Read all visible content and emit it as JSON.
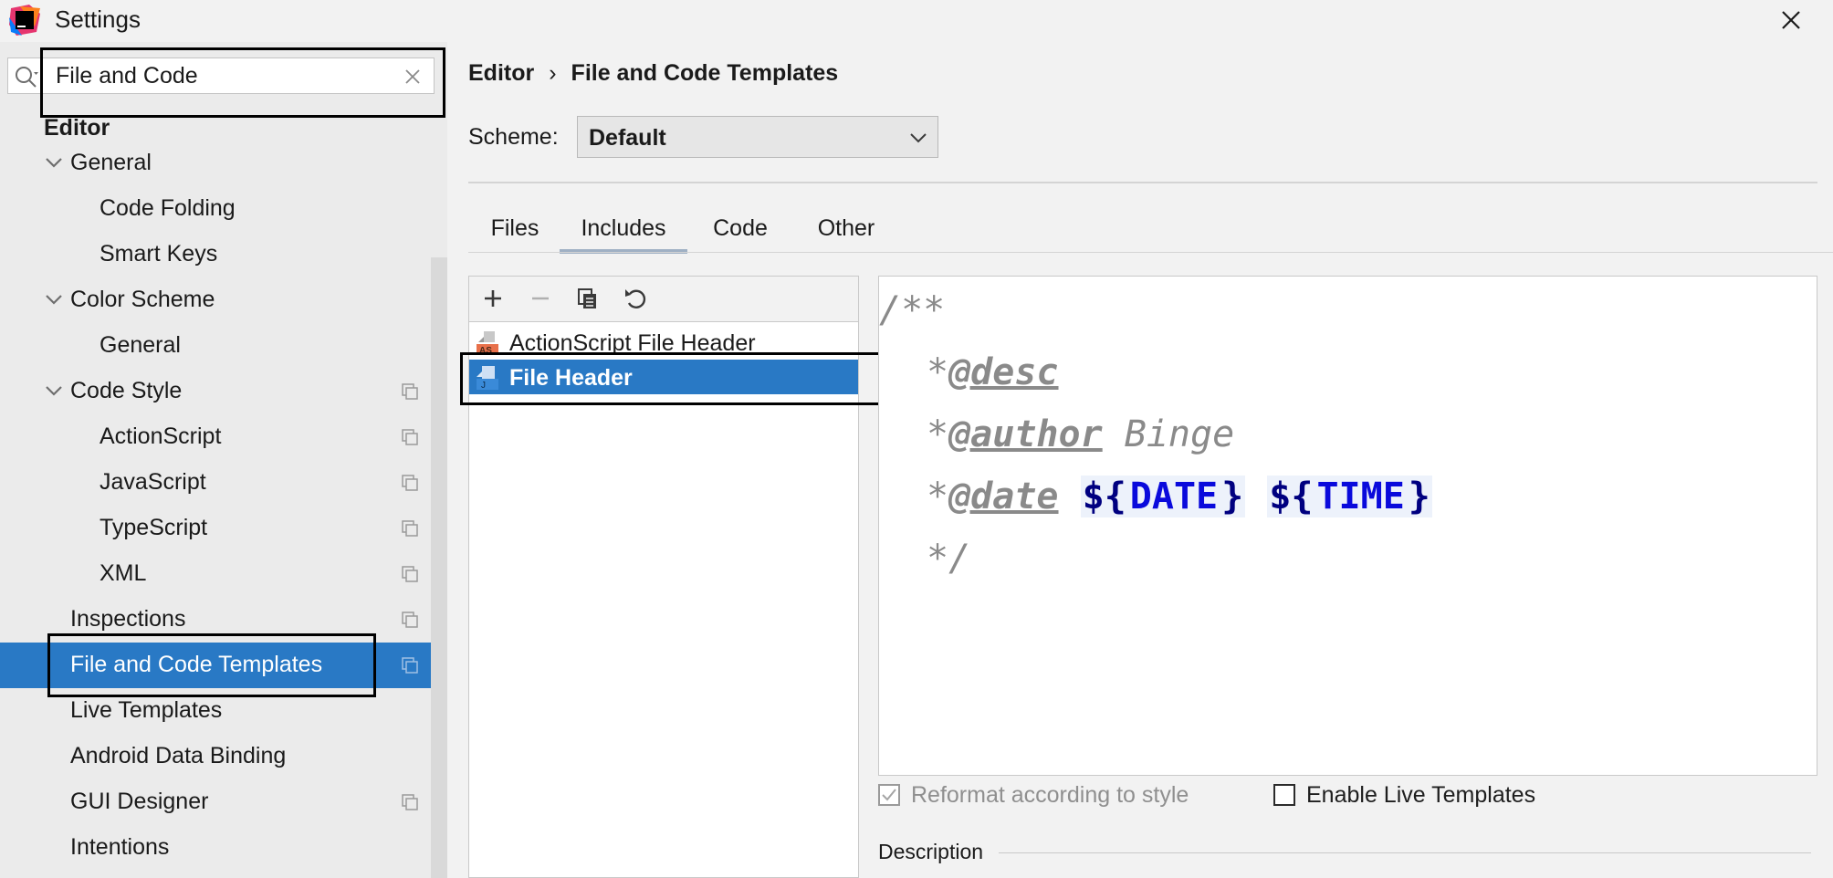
{
  "window": {
    "title": "Settings"
  },
  "search": {
    "value": "File and Code",
    "placeholder": ""
  },
  "sidebar": {
    "section": "Editor",
    "items": [
      {
        "label": "General"
      },
      {
        "label": "Code Folding"
      },
      {
        "label": "Smart Keys"
      },
      {
        "label": "Color Scheme"
      },
      {
        "label": "General"
      },
      {
        "label": "Code Style"
      },
      {
        "label": "ActionScript"
      },
      {
        "label": "JavaScript"
      },
      {
        "label": "TypeScript"
      },
      {
        "label": "XML"
      },
      {
        "label": "Inspections"
      },
      {
        "label": "File and Code Templates"
      },
      {
        "label": "Live Templates"
      },
      {
        "label": "Android Data Binding"
      },
      {
        "label": "GUI Designer"
      },
      {
        "label": "Intentions"
      }
    ]
  },
  "breadcrumb": {
    "parent": "Editor",
    "separator": "›",
    "current": "File and Code Templates"
  },
  "scheme": {
    "label": "Scheme:",
    "value": "Default"
  },
  "tabs": [
    {
      "label": "Files"
    },
    {
      "label": "Includes"
    },
    {
      "label": "Code"
    },
    {
      "label": "Other"
    }
  ],
  "templates": [
    {
      "label": "ActionScript File Header",
      "icon": "actionscript-file-icon",
      "icon_badge": "AS"
    },
    {
      "label": "File Header",
      "icon": "java-file-icon",
      "icon_badge": "J"
    }
  ],
  "editor": {
    "line1": "/**",
    "line2_star": "*",
    "line2_tag": "@desc",
    "line3_star": "*",
    "line3_tag": "@author",
    "line3_text": " Binge",
    "line4_star": "*",
    "line4_tag": "@date",
    "line4_var1_open": "${",
    "line4_var1_name": "DATE",
    "line4_var1_close": "}",
    "line4_var2_open": "${",
    "line4_var2_name": "TIME",
    "line4_var2_close": "}",
    "line5": "*/"
  },
  "options": {
    "reformat_label": "Reformat according to style",
    "live_templates_label": "Enable Live Templates"
  },
  "description": {
    "label": "Description"
  },
  "colors": {
    "selection": "#2979c5",
    "variable": "#0a0adc",
    "comment": "#8a8a8a"
  }
}
